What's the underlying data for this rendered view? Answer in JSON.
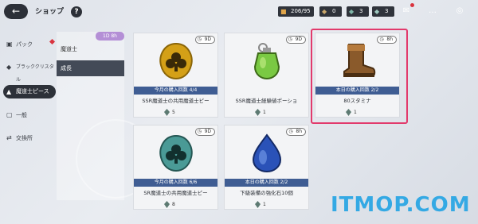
{
  "header": {
    "title": "ショップ",
    "help": "?"
  },
  "resources": {
    "stamina": "206/95",
    "currency_a": "0",
    "currency_b": "3",
    "currency_c": "3"
  },
  "sidebar": {
    "items": [
      {
        "label": "パック"
      },
      {
        "label": "ブラッククリスタル"
      },
      {
        "label": "魔道士ピース"
      },
      {
        "label": "一般"
      },
      {
        "label": "交換所"
      }
    ]
  },
  "submenu": {
    "badge": "1D 8h",
    "items": [
      {
        "label": "魔道士"
      },
      {
        "label": "成長"
      }
    ]
  },
  "cards": [
    {
      "timer": "9D",
      "limit": "今月の購入回数 4/4",
      "name": "SSR魔道士の共用魔道士ピー",
      "price": "5",
      "art_color": "#d4a017"
    },
    {
      "timer": "9D",
      "limit": "",
      "name": "SSR魔道士経験値ポーショ",
      "price": "1",
      "art_color": "#7ac943"
    },
    {
      "timer": "8h",
      "limit": "本日の購入回数 2/2",
      "name": "80スタミナ",
      "price": "1",
      "art_color": "#8a5a2b"
    },
    {
      "timer": "9D",
      "limit": "今月の購入回数 6/6",
      "name": "SR魔道士の共用魔道士ピー",
      "price": "8",
      "art_color": "#4a9a96"
    },
    {
      "timer": "8h",
      "limit": "本日の購入回数 2/2",
      "name": "下級装備の強化石10個",
      "price": "1",
      "art_color": "#2a52b8"
    }
  ],
  "watermark": "ITMOP.COM"
}
